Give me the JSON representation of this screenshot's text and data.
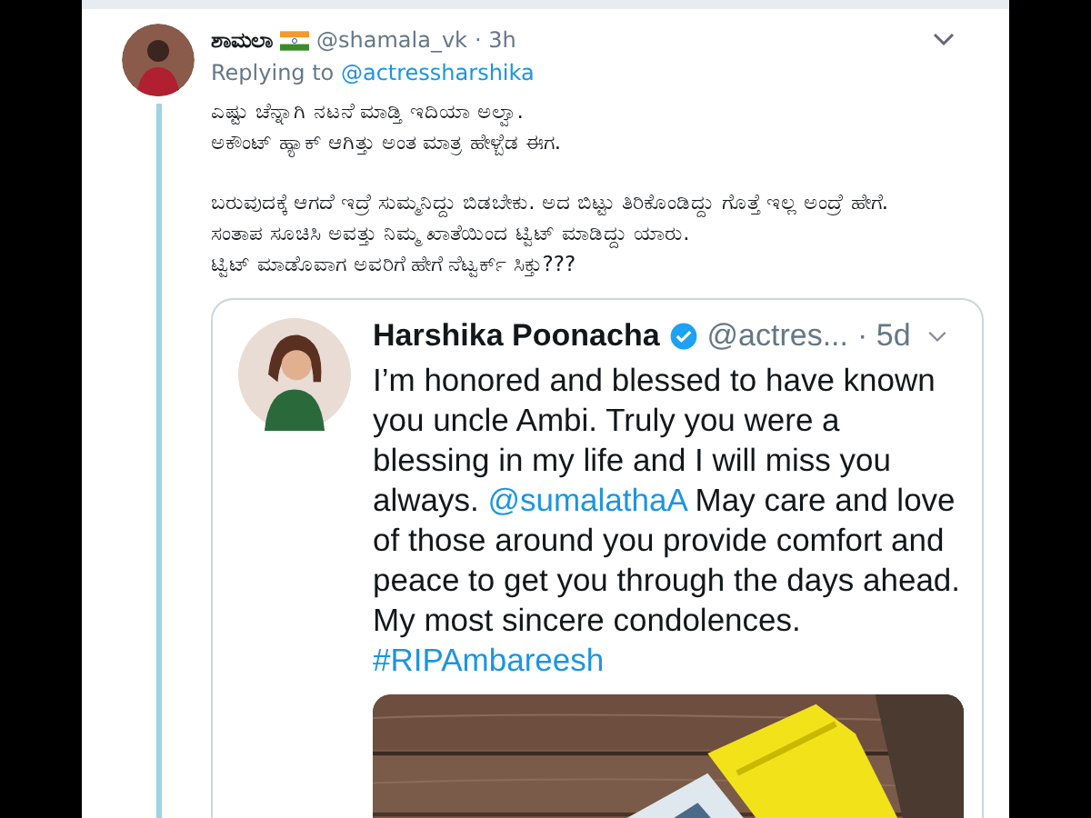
{
  "tweet": {
    "name": "ಶಾಮಲಾ",
    "handle": "@shamala_vk",
    "time": "· 3h",
    "replying": [
      {
        "kind": "text",
        "text": "Replying to "
      },
      {
        "kind": "link",
        "text": "@actressharshika"
      }
    ],
    "paragraphs": [
      [
        "ಎಷ್ಟು ಚೆನ್ನಾಗಿ ನಟನೆ ಮಾಡ್ತಿ ಇದಿಯಾ ಅಲ್ವಾ.",
        "ಅಕೌಂಟ್ ಹ್ಯಾಕ್ ಆಗಿತ್ತು ಅಂತ ಮಾತ್ರ ಹೇಳ್ಬೆಡ ಈಗ."
      ],
      [
        "ಬರುವುದಕ್ಕೆ ಆಗದೆ ಇದ್ರೆ ಸುಮ್ಮನಿದ್ದು ಬಿಡಬೇಕು. ಅದ ಬಿಟ್ಟು ತಿರಿಕೊಂಡಿದ್ದು ಗೊತ್ತೆ ಇಲ್ಲ ಅಂದ್ರೆ ಹೇಗೆ.",
        "ಸಂತಾಪ ಸೂಚಿಸಿ ಅವತ್ತು ನಿಮ್ಮ ಖಾತೆಯಿಂದ ಟ್ವಿಟ್ ಮಾಡಿದ್ದು ಯಾರು.",
        "ಟ್ವಿಟ್ ಮಾಡೊವಾಗ ಅವರಿಗೆ ಹೇಗೆ ನೆಟ್ವರ್ಕ್ ಸಿಕ್ತು???"
      ]
    ]
  },
  "quoted": {
    "name": "Harshika Poonacha",
    "verified": true,
    "handle": "@actres...",
    "time": "· 5d",
    "text": [
      {
        "kind": "text",
        "text": "I’m honored and blessed to have known you uncle Ambi. Truly you were a blessing in my life and I will miss you always. "
      },
      {
        "kind": "link",
        "text": "@sumalathaA"
      },
      {
        "kind": "text",
        "text": "  May care and love of those around you provide comfort and peace to get you through the days ahead. My most sincere condolences. "
      },
      {
        "kind": "link",
        "text": "#RIPAmbareesh"
      }
    ]
  }
}
